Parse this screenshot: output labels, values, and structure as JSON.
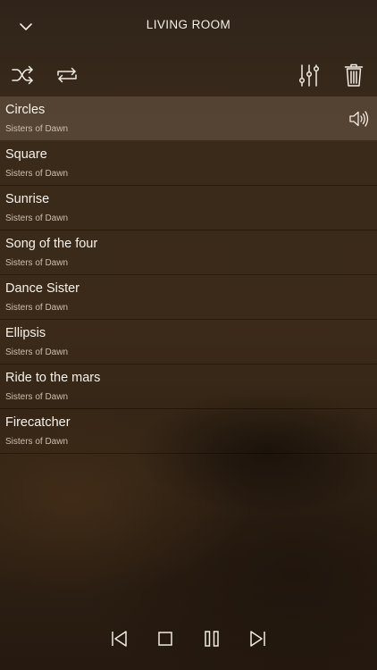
{
  "header": {
    "title": "LIVING ROOM",
    "back_icon": "chevron-down-icon"
  },
  "toolbar": {
    "left_icons": [
      "shuffle-icon",
      "repeat-icon"
    ],
    "right_icons": [
      "equalizer-icon",
      "trash-icon"
    ]
  },
  "playlist": [
    {
      "title": "Circles",
      "artist": "Sisters of Dawn",
      "playing": true
    },
    {
      "title": "Square",
      "artist": "Sisters of Dawn"
    },
    {
      "title": "Sunrise",
      "artist": "Sisters of Dawn"
    },
    {
      "title": "Song of the four",
      "artist": "Sisters of Dawn"
    },
    {
      "title": "Dance Sister",
      "artist": "Sisters of Dawn"
    },
    {
      "title": "Ellipsis",
      "artist": "Sisters of Dawn"
    },
    {
      "title": "Ride to the mars",
      "artist": "Sisters of Dawn"
    },
    {
      "title": "Firecatcher",
      "artist": "Sisters of Dawn"
    }
  ],
  "playback_controls": [
    "previous-icon",
    "stop-icon",
    "pause-icon",
    "next-icon"
  ],
  "colors": {
    "text": "#f2ece3",
    "subtext": "#cdbfae",
    "active_row": "#6f5d4c",
    "background": "#3a2a1a"
  }
}
